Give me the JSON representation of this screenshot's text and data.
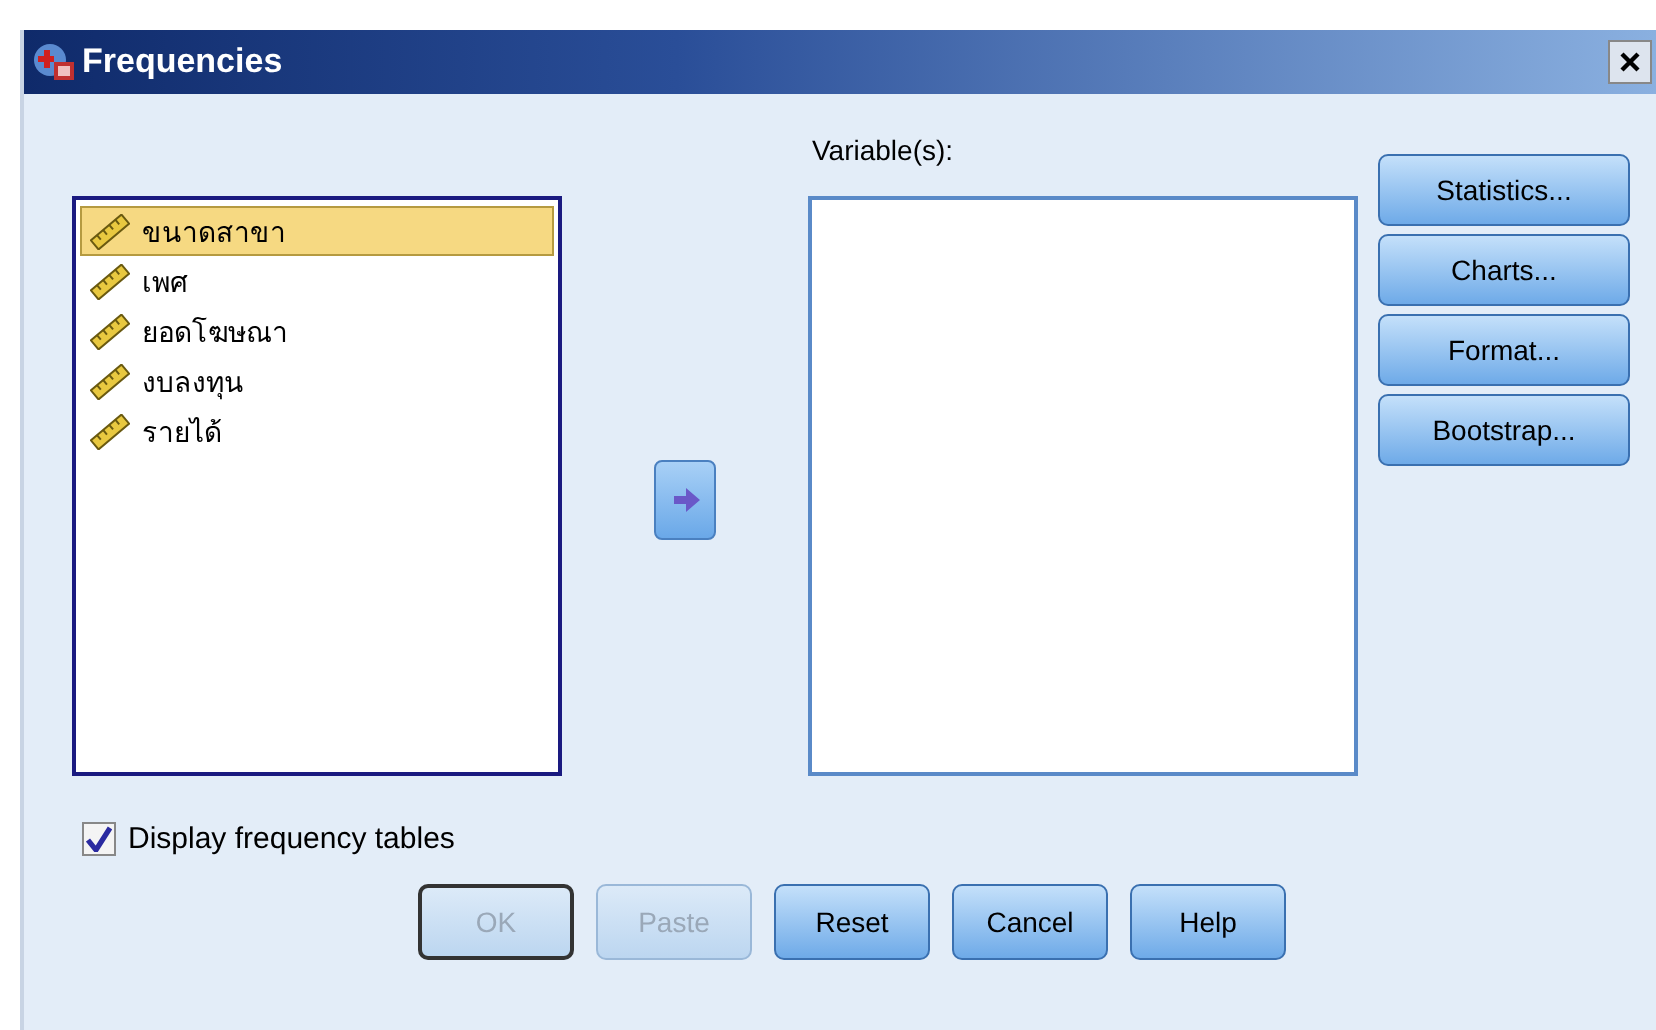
{
  "window": {
    "title": "Frequencies"
  },
  "source_list": {
    "items": [
      {
        "label": "ขนาดสาขา",
        "selected": true
      },
      {
        "label": "เพศ",
        "selected": false
      },
      {
        "label": "ยอดโฆษณา",
        "selected": false
      },
      {
        "label": "งบลงทุน",
        "selected": false
      },
      {
        "label": "รายได้",
        "selected": false
      }
    ]
  },
  "variables": {
    "label": "Variable(s):"
  },
  "side_buttons": [
    {
      "label": "Statistics...",
      "disabled": false
    },
    {
      "label": "Charts...",
      "disabled": false
    },
    {
      "label": "Format...",
      "disabled": false
    },
    {
      "label": "Bootstrap...",
      "disabled": false
    }
  ],
  "display_tables": {
    "label": "Display frequency tables",
    "checked": true
  },
  "buttons": [
    {
      "label": "OK",
      "disabled": true
    },
    {
      "label": "Paste",
      "disabled": true
    },
    {
      "label": "Reset",
      "disabled": false
    },
    {
      "label": "Cancel",
      "disabled": false
    },
    {
      "label": "Help",
      "disabled": false
    }
  ]
}
